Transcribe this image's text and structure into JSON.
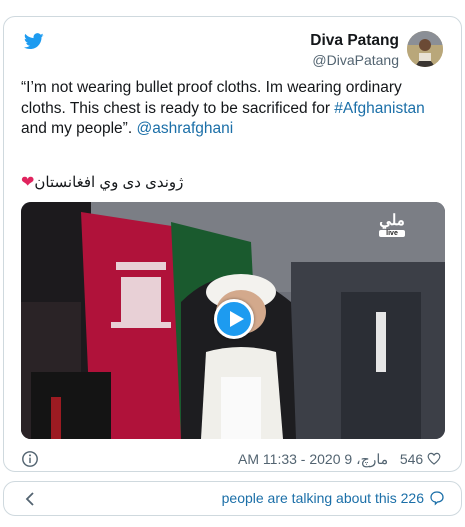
{
  "author": {
    "name": "Diva Patang",
    "handle": "@DivaPatang"
  },
  "tweet": {
    "text_part1": "“I’m not wearing bullet proof cloths. Im wearing ordinary cloths. This chest is ready to be sacrificed for ",
    "hashtag": "#Afghanistan",
    "text_part2": " and my people”. ",
    "mention": "@ashrafghani",
    "pashto_line": "ژوندی دی وي افغانستان"
  },
  "media": {
    "logo_text": "ملي",
    "live_label": "live"
  },
  "footer": {
    "likes": "546",
    "timestamp": "مارچ، 9 2020 - AM 11:33"
  },
  "bottom": {
    "talk_label": "people are talking about this 226"
  },
  "colors": {
    "link": "#1b6fa8",
    "heart": "#e0245e",
    "play": "#1d9bf0"
  },
  "icons": {
    "logo": "twitter-bird-icon",
    "like": "heart-outline-icon",
    "info": "info-icon",
    "back": "chevron-left-icon",
    "reply": "speech-bubble-icon"
  }
}
